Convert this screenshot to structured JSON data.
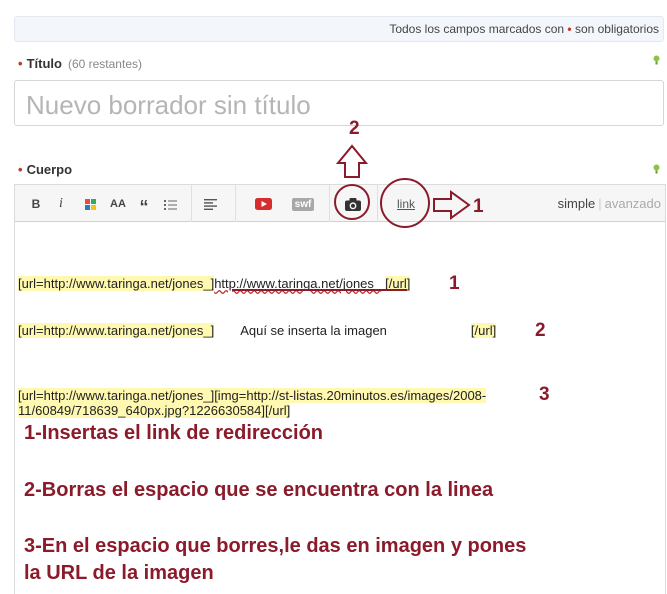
{
  "notice": {
    "text_before": "Todos los campos marcados con ",
    "dot": "•",
    "text_after": " son obligatorios"
  },
  "title_field": {
    "label": "Título",
    "remaining": "(60 restantes)",
    "placeholder": "Nuevo borrador sin título",
    "required_dot": "•"
  },
  "body_field": {
    "label": "Cuerpo",
    "required_dot": "•"
  },
  "toolbar": {
    "bold": "B",
    "italic": "i",
    "font_size": "AA",
    "quote": "“",
    "swf": "swf",
    "link": "link",
    "mode_simple": "simple",
    "mode_divider": "|",
    "mode_advanced": "avanzado"
  },
  "editor": {
    "line1": {
      "tag_open": "[url=http://www.taringa.net/jones_]",
      "link_text": "http://www.taringa.net/jones_",
      "tag_close": "[/url]"
    },
    "line2": {
      "tag_open": "[url=http://www.taringa.net/jones_]",
      "middle": "Aquí se inserta la imagen",
      "tag_close": "[/url]"
    },
    "line3": {
      "part1": "[url=http://www.taringa.net/jones_][img=http://st-listas.20minutos.es/images/2008-",
      "part2": "11/60849/718639_640px.jpg?1226630584][/url]"
    }
  },
  "annotations": {
    "num_toolbar_1": "1",
    "num_toolbar_2": "2",
    "num_line1": "1",
    "num_line2": "2",
    "num_line3": "3",
    "step1": "1-Insertas el link de redirección",
    "step2": "2-Borras el espacio que se encuentra con la linea",
    "step3a": "3-En el espacio que borres,le das en imagen y pones",
    "step3b": "la URL de la imagen"
  },
  "colors": {
    "annotation": "#8b1a2b",
    "required": "#c0392b",
    "highlight": "#fff8b0",
    "hint_icon": "#8bc34a"
  },
  "icons": [
    "bold-icon",
    "italic-icon",
    "color-icon",
    "font-size-icon",
    "quote-icon",
    "list-icon",
    "align-icon",
    "youtube-icon",
    "swf-icon",
    "camera-icon",
    "link-icon",
    "hint-icon"
  ]
}
